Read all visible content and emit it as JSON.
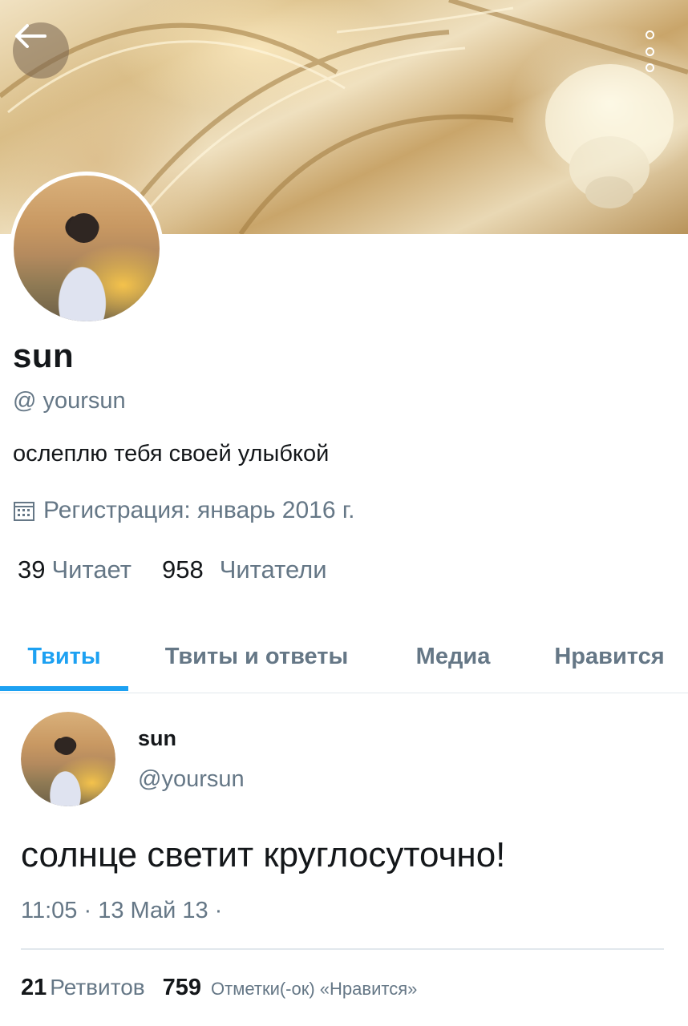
{
  "profile": {
    "name": "sun",
    "handle": "@ yoursun",
    "bio": "ослеплю тебя своей улыбкой",
    "joined": "Регистрация: январь 2016 г.",
    "following_count": "39",
    "following_label": "Читает",
    "followers_count": "958",
    "followers_label": "Читатели"
  },
  "tabs": [
    {
      "label": "Твиты",
      "active": true
    },
    {
      "label": "Твиты и ответы",
      "active": false
    },
    {
      "label": "Медиа",
      "active": false
    },
    {
      "label": "Нравится",
      "active": false
    }
  ],
  "tweet": {
    "name": "sun",
    "handle": "@yoursun",
    "text": "солнце светит круглосуточно!",
    "meta": "11:05 · 13 Май 13 ·",
    "retweets_count": "21",
    "retweets_label": "Ретвитов",
    "likes_count": "759",
    "likes_label": "Отметки(-ок) «Нравится»"
  },
  "colors": {
    "accent": "#1da1f2",
    "muted": "#657786",
    "text": "#14171a"
  },
  "icons": {
    "back": "arrow-left-icon",
    "more": "more-vertical-icon",
    "calendar": "calendar-icon"
  }
}
